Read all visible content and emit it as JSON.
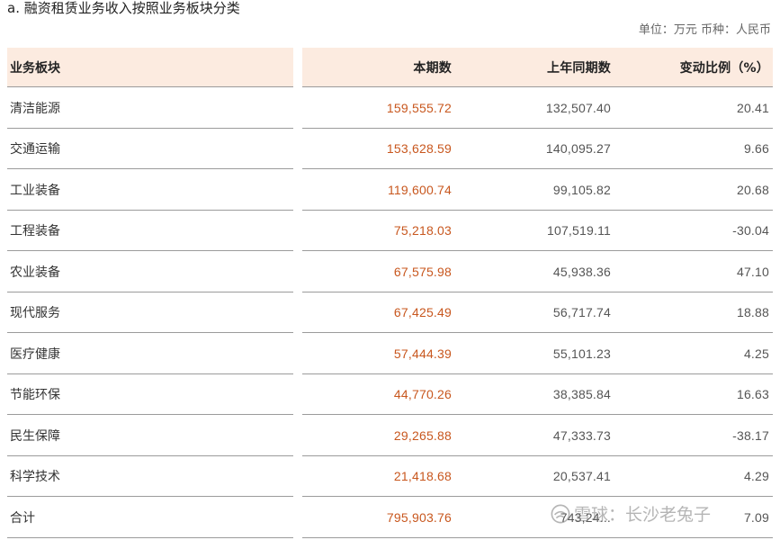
{
  "title": "a. 融资租赁业务收入按照业务板块分类",
  "unit_note": "单位：万元  币种：人民币",
  "columns": [
    "业务板块",
    "本期数",
    "上年同期数",
    "变动比例（%）"
  ],
  "rows": [
    {
      "segment": "清洁能源",
      "current": "159,555.72",
      "prior": "132,507.40",
      "change": "20.41"
    },
    {
      "segment": "交通运输",
      "current": "153,628.59",
      "prior": "140,095.27",
      "change": "9.66"
    },
    {
      "segment": "工业装备",
      "current": "119,600.74",
      "prior": "99,105.82",
      "change": "20.68"
    },
    {
      "segment": "工程装备",
      "current": "75,218.03",
      "prior": "107,519.11",
      "change": "-30.04"
    },
    {
      "segment": "农业装备",
      "current": "67,575.98",
      "prior": "45,938.36",
      "change": "47.10"
    },
    {
      "segment": "现代服务",
      "current": "67,425.49",
      "prior": "56,717.74",
      "change": "18.88"
    },
    {
      "segment": "医疗健康",
      "current": "57,444.39",
      "prior": "55,101.23",
      "change": "4.25"
    },
    {
      "segment": "节能环保",
      "current": "44,770.26",
      "prior": "38,385.84",
      "change": "16.63"
    },
    {
      "segment": "民生保障",
      "current": "29,265.88",
      "prior": "47,333.73",
      "change": "-38.17"
    },
    {
      "segment": "科学技术",
      "current": "21,418.68",
      "prior": "20,537.41",
      "change": "4.29"
    },
    {
      "segment": "合计",
      "current": "795,903.76",
      "prior": "743,24...",
      "change": "7.09"
    }
  ],
  "watermark": {
    "text": "雪球：长沙老兔子",
    "icon": "snowball-logo-icon"
  },
  "colors": {
    "header_bg": "#fcebe0",
    "accent_value": "#c8571e",
    "rule": "#9b9b9b"
  }
}
